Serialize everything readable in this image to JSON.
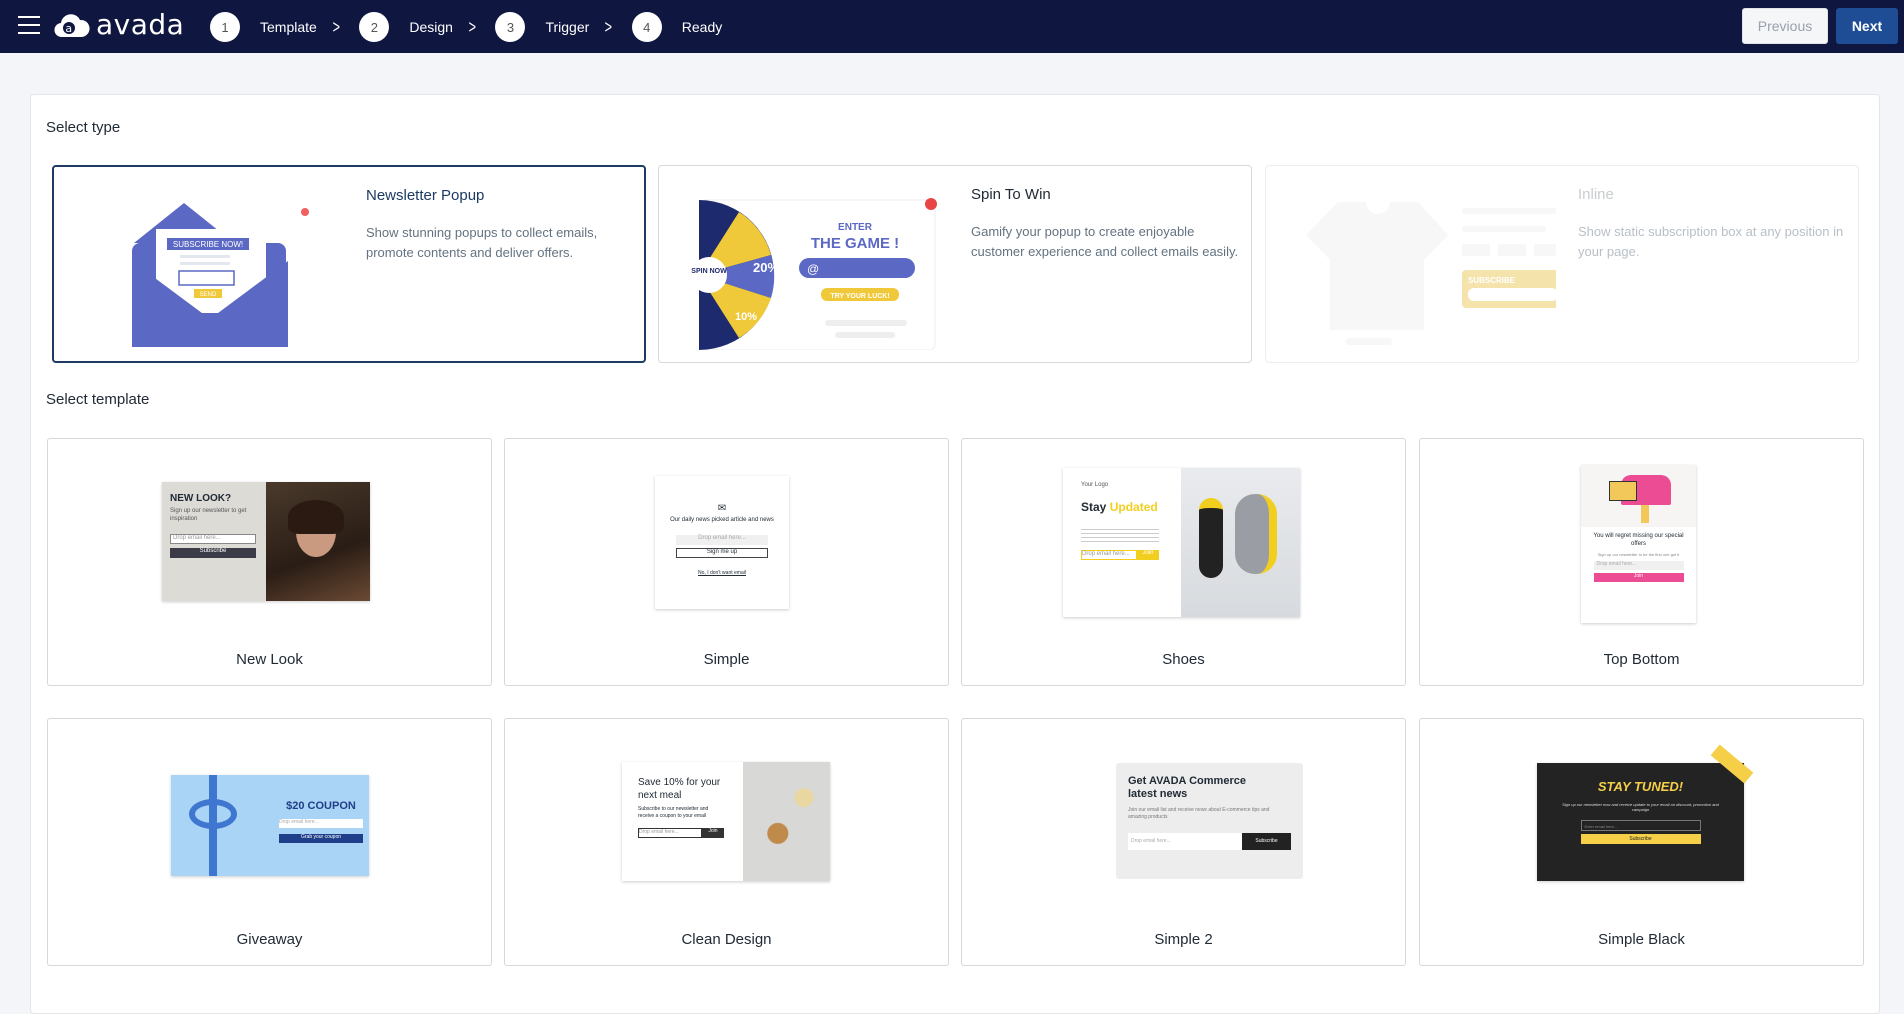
{
  "header": {
    "logo_text": "avada",
    "steps": [
      {
        "num": "1",
        "label": "Template"
      },
      {
        "num": "2",
        "label": "Design"
      },
      {
        "num": "3",
        "label": "Trigger"
      },
      {
        "num": "4",
        "label": "Ready"
      }
    ],
    "previous_label": "Previous",
    "next_label": "Next"
  },
  "select_type": {
    "heading": "Select type",
    "selected": "Newsletter Popup",
    "types": [
      {
        "title": "Newsletter Popup",
        "description": "Show stunning popups to collect emails, promote contents and deliver offers.",
        "art_text": [
          "SUBSCRIBE NOW!",
          "SEND"
        ]
      },
      {
        "title": "Spin To Win",
        "description": "Gamify your popup to create enjoyable customer experience and collect emails easily.",
        "art_text": [
          "ENTER",
          "THE GAME !",
          "@",
          "TRY YOUR LUCK!",
          "SPIN NOW",
          "20%",
          "10%"
        ]
      },
      {
        "title": "Inline",
        "description": "Show static subscription box at any position in your page.",
        "art_text": [
          "SUBSCRIBE"
        ],
        "disabled": true
      }
    ]
  },
  "select_template": {
    "heading": "Select template",
    "templates": [
      {
        "name": "New Look",
        "thumb": {
          "title": "NEW LOOK?",
          "text": "Sign up our newsletter to get inspiration",
          "input": "Drop email here...",
          "button": "Subscribe"
        }
      },
      {
        "name": "Simple",
        "thumb": {
          "title": "Our daily news picked article and news",
          "input": "Drop email here...",
          "button": "Sign me up",
          "link": "No, I don't want email"
        }
      },
      {
        "name": "Shoes",
        "thumb": {
          "logo": "Your Logo",
          "title": "Stay",
          "accent": "Updated",
          "input": "Drop email here...",
          "button": "Join"
        }
      },
      {
        "name": "Top Bottom",
        "thumb": {
          "title": "You will regret missing our special offers",
          "text": "Sign up our newsletter to be the first one get it",
          "input": "Drop email here...",
          "button": "Join"
        }
      },
      {
        "name": "Giveaway",
        "thumb": {
          "title": "$20 COUPON",
          "input": "Drop email here...",
          "button": "Grab your coupon"
        }
      },
      {
        "name": "Clean Design",
        "thumb": {
          "title": "Save 10% for your next meal",
          "text": "Subscribe to our newsletter and receive a coupon to your email",
          "input": "Drop email here...",
          "button": "Join"
        }
      },
      {
        "name": "Simple 2",
        "thumb": {
          "title": "Get AVADA Commerce latest news",
          "text": "Join our email list and receive news about E-commerce tips and amazing products",
          "input": "Drop email here...",
          "button": "Subscribe"
        }
      },
      {
        "name": "Simple Black",
        "thumb": {
          "title": "STAY TUNED!",
          "text": "Sign up our newsletter now and receive update to your email on discount, promotion and campaign",
          "input": "Enter email here...",
          "button": "Subscribe"
        }
      }
    ]
  },
  "colors": {
    "topbar": "#0f1640",
    "next_button": "#1f4d95",
    "selected_border": "#1c3a62",
    "illustration": "#5b68c4",
    "accent_yellow": "#f0c93a",
    "pink": "#ec4c93"
  }
}
